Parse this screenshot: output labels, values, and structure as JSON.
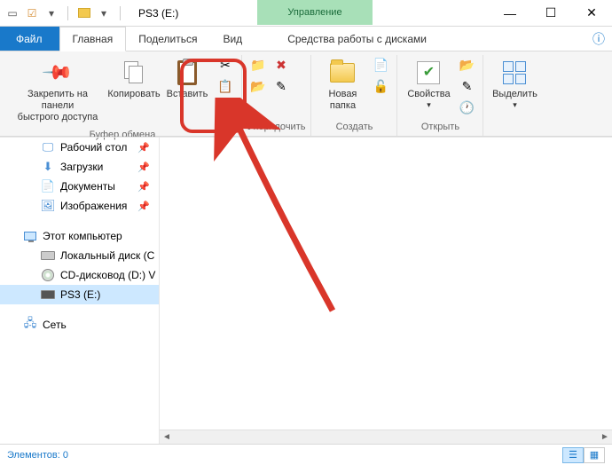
{
  "title": "PS3 (E:)",
  "context_tab_header": "Управление",
  "tabs": {
    "file": "Файл",
    "home": "Главная",
    "share": "Поделиться",
    "view": "Вид",
    "drive_tools": "Средства работы с дисками"
  },
  "ribbon": {
    "pin": {
      "label_line1": "Закрепить на панели",
      "label_line2": "быстрого доступа"
    },
    "copy": "Копировать",
    "paste": "Вставить",
    "group_clipboard": "Буфер обмена",
    "group_organize": "Упорядочить",
    "new_folder": {
      "line1": "Новая",
      "line2": "папка"
    },
    "group_create": "Создать",
    "properties": "Свойства",
    "group_open": "Открыть",
    "select": "Выделить"
  },
  "nav": {
    "desktop": "Рабочий стол",
    "downloads": "Загрузки",
    "documents": "Документы",
    "pictures": "Изображения",
    "this_pc": "Этот компьютер",
    "local_disk": "Локальный диск (C",
    "cd_drive": "CD-дисковод (D:) V",
    "ps3": "PS3 (E:)",
    "network": "Сеть"
  },
  "status": {
    "elements": "Элементов: 0"
  }
}
